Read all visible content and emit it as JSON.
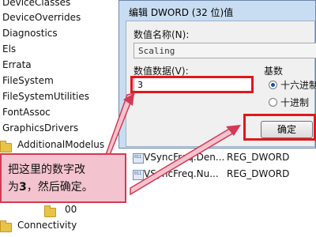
{
  "tree": {
    "items": [
      "DeviceClasses",
      "DeviceOverrides",
      "Diagnostics",
      "Els",
      "Errata",
      "FileSystem",
      "FileSystemUtilities",
      "FontAssoc",
      "GraphicsDrivers"
    ],
    "folders": [
      "AdditionalModelus",
      "00",
      "Connectivity"
    ]
  },
  "values": [
    {
      "name": "VSyncFreq.Den...",
      "type": "REG_DWORD"
    },
    {
      "name": "VSyncFreq.Nu...",
      "type": "REG_DWORD"
    }
  ],
  "dialog": {
    "title": "编辑 DWORD (32 位)值",
    "name_label": "数值名称(N):",
    "name_value": "Scaling",
    "data_label": "数值数据(V):",
    "data_value": "3",
    "base_label": "基数",
    "radio_hex": "十六进制",
    "radio_dec": "十进制",
    "ok_label": "确定"
  },
  "annotation": {
    "line1": "把这里的数字改",
    "line2_prefix": "为",
    "line2_bold": "3",
    "line2_suffix": "，然后确定。"
  },
  "colors": {
    "highlight": "#e0181b",
    "callout_bg": "#f3c3cf",
    "callout_border": "#d33a55"
  }
}
